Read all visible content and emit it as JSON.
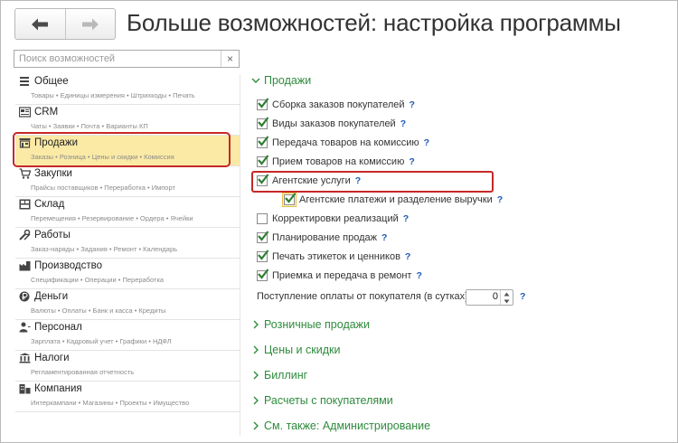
{
  "header": {
    "title": "Больше возможностей: настройка программы"
  },
  "search": {
    "placeholder": "Поиск возможностей",
    "clear": "×"
  },
  "sidebar": {
    "sections": [
      {
        "title": "Общее",
        "sub": "Товары • Единицы измерения • Штрихкоды • Печать",
        "icon": "list-icon"
      },
      {
        "title": "CRM",
        "sub": "Чаты • Заявки • Почта • Варианты КП",
        "icon": "crm-icon"
      },
      {
        "title": "Продажи",
        "sub": "Заказы • Розница • Цены и скидки • Комиссия",
        "icon": "shop-icon"
      },
      {
        "title": "Закупки",
        "sub": "Прайсы поставщиков • Переработка • Импорт",
        "icon": "cart-icon"
      },
      {
        "title": "Склад",
        "sub": "Перемещения • Резервирование • Ордера • Ячейки",
        "icon": "warehouse-icon"
      },
      {
        "title": "Работы",
        "sub": "Заказ-наряды • Задания • Ремонт • Календарь",
        "icon": "tools-icon"
      },
      {
        "title": "Производство",
        "sub": "Спецификации • Операции • Переработка",
        "icon": "factory-icon"
      },
      {
        "title": "Деньги",
        "sub": "Валюты • Оплаты • Банк и касса • Кредиты",
        "icon": "money-icon"
      },
      {
        "title": "Персонал",
        "sub": "Зарплата • Кадровый учет • Графики • НДФЛ",
        "icon": "person-icon"
      },
      {
        "title": "Налоги",
        "sub": "Регламентированная отчетность",
        "icon": "taxes-icon"
      },
      {
        "title": "Компания",
        "sub": "Интеркампани • Магазины • Проекты • Имущество",
        "icon": "company-icon"
      }
    ]
  },
  "panel": {
    "sales_group": "Продажи",
    "options": [
      {
        "label": "Сборка заказов покупателей",
        "checked": true
      },
      {
        "label": "Виды заказов покупателей",
        "checked": true
      },
      {
        "label": "Передача товаров на комиссию",
        "checked": true
      },
      {
        "label": "Прием товаров на комиссию",
        "checked": true
      },
      {
        "label": "Агентские услуги",
        "checked": true
      },
      {
        "label": "Агентские платежи и разделение выручки",
        "checked": true
      },
      {
        "label": "Корректировки реализаций",
        "checked": false
      },
      {
        "label": "Планирование продаж",
        "checked": true
      },
      {
        "label": "Печать этикеток и ценников",
        "checked": true
      },
      {
        "label": "Приемка и передача в ремонт",
        "checked": true
      }
    ],
    "help": "?",
    "payment_label": "Поступление оплаты от покупателя (в сутках):",
    "payment_value": "0",
    "groups": [
      "Розничные продажи",
      "Цены и скидки",
      "Биллинг",
      "Расчеты с покупателями",
      "См. также: Администрирование"
    ]
  },
  "colors": {
    "accent_green": "#2e8b3d",
    "highlight": "#c62828",
    "active_bg": "#fbeaa6",
    "help_blue": "#1e5bb5"
  }
}
